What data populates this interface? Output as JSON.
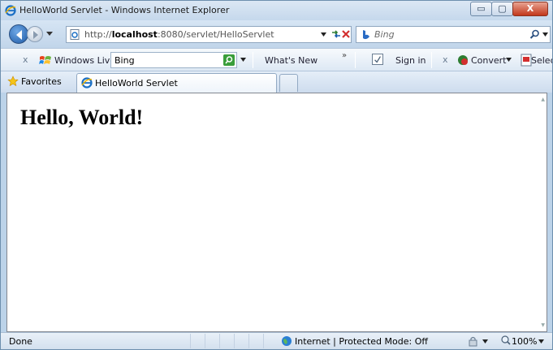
{
  "window": {
    "title": "HelloWorld Servlet - Windows Internet Explorer",
    "controls": {
      "minimize": "▭",
      "maximize": "▢",
      "close": "X"
    }
  },
  "address_bar": {
    "url_prefix": "http://",
    "url_host": "localhost",
    "url_rest": ":8080/servlet/HelloServlet",
    "search_placeholder": "Bing"
  },
  "toolbar": {
    "close_glyph": "x",
    "windows_live_label": "Windows Live",
    "search_value": "Bing",
    "whats_new": "What's New",
    "chevron": "»",
    "sign_in": "Sign in",
    "close_glyph_2": "x",
    "convert": "Convert",
    "select": "Select"
  },
  "favorites_bar": {
    "favorites_label": "Favorites",
    "tab_label": "HelloWorld Servlet"
  },
  "page": {
    "heading": "Hello, World!"
  },
  "status_bar": {
    "status": "Done",
    "zone": "Internet | Protected Mode: Off",
    "zoom": "100%"
  },
  "colors": {
    "frame": "#bcd3e9",
    "close_button": "#c2371b",
    "back_button": "#1d5aa6"
  },
  "icons": [
    "ie-icon",
    "back-icon",
    "forward-icon",
    "page-icon",
    "refresh-icon",
    "stop-icon",
    "bing-icon",
    "search-icon",
    "windows-live-icon",
    "signin-icon",
    "convert-icon",
    "select-icon",
    "star-icon",
    "globe-icon",
    "lock-icon",
    "zoom-icon"
  ]
}
